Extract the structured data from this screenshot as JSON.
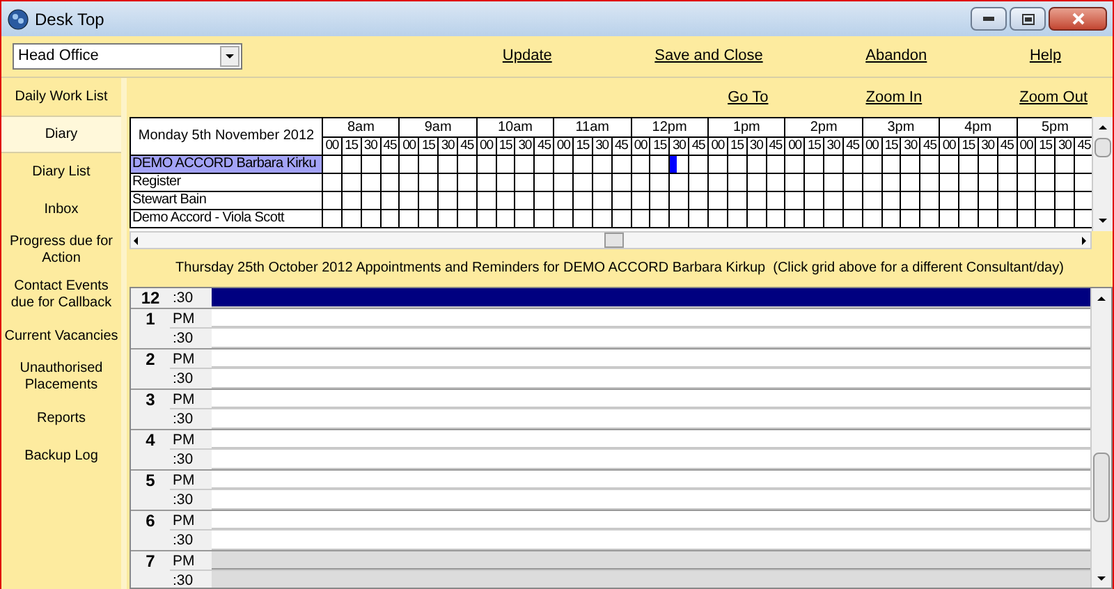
{
  "window": {
    "title": "Desk Top"
  },
  "office_select": {
    "value": "Head Office"
  },
  "menu_links": [
    "Update",
    "Save and Close",
    "Abandon",
    "Help"
  ],
  "sidebar": {
    "items": [
      {
        "label": "Daily Work List",
        "selected": false
      },
      {
        "label": "Diary",
        "selected": true
      },
      {
        "label": "Diary List",
        "selected": false
      },
      {
        "label": "Inbox",
        "selected": false
      },
      {
        "label": "Progress due for Action",
        "selected": false
      },
      {
        "label": "Contact Events due for Callback",
        "selected": false
      },
      {
        "label": "Current Vacancies",
        "selected": false
      },
      {
        "label": "Unauthorised Placements",
        "selected": false
      },
      {
        "label": "Reports",
        "selected": false
      },
      {
        "label": "Backup Log",
        "selected": false
      }
    ]
  },
  "grid_links": [
    "Go To",
    "Zoom In",
    "Zoom Out"
  ],
  "overview": {
    "date": "Monday 5th November 2012",
    "hours": [
      {
        "label": "8am",
        "minutes": [
          {
            "label": "00",
            "cursor": false
          },
          {
            "label": "15",
            "cursor": false
          },
          {
            "label": "30",
            "cursor": false
          },
          {
            "label": "45",
            "cursor": false
          }
        ]
      },
      {
        "label": "9am",
        "minutes": [
          {
            "label": "00",
            "cursor": false
          },
          {
            "label": "15",
            "cursor": false
          },
          {
            "label": "30",
            "cursor": false
          },
          {
            "label": "45",
            "cursor": false
          }
        ]
      },
      {
        "label": "10am",
        "minutes": [
          {
            "label": "00",
            "cursor": false
          },
          {
            "label": "15",
            "cursor": false
          },
          {
            "label": "30",
            "cursor": false
          },
          {
            "label": "45",
            "cursor": false
          }
        ]
      },
      {
        "label": "11am",
        "minutes": [
          {
            "label": "00",
            "cursor": false
          },
          {
            "label": "15",
            "cursor": false
          },
          {
            "label": "30",
            "cursor": false
          },
          {
            "label": "45",
            "cursor": false
          }
        ]
      },
      {
        "label": "12pm",
        "minutes": [
          {
            "label": "00",
            "cursor": false
          },
          {
            "label": "15",
            "cursor": false
          },
          {
            "label": "30",
            "cursor": true
          },
          {
            "label": "45",
            "cursor": false
          }
        ]
      },
      {
        "label": "1pm",
        "minutes": [
          {
            "label": "00",
            "cursor": false
          },
          {
            "label": "15",
            "cursor": false
          },
          {
            "label": "30",
            "cursor": false
          },
          {
            "label": "45",
            "cursor": false
          }
        ]
      },
      {
        "label": "2pm",
        "minutes": [
          {
            "label": "00",
            "cursor": false
          },
          {
            "label": "15",
            "cursor": false
          },
          {
            "label": "30",
            "cursor": false
          },
          {
            "label": "45",
            "cursor": false
          }
        ]
      },
      {
        "label": "3pm",
        "minutes": [
          {
            "label": "00",
            "cursor": false
          },
          {
            "label": "15",
            "cursor": false
          },
          {
            "label": "30",
            "cursor": false
          },
          {
            "label": "45",
            "cursor": false
          }
        ]
      },
      {
        "label": "4pm",
        "minutes": [
          {
            "label": "00",
            "cursor": false
          },
          {
            "label": "15",
            "cursor": false
          },
          {
            "label": "30",
            "cursor": false
          },
          {
            "label": "45",
            "cursor": false
          }
        ]
      },
      {
        "label": "5pm",
        "minutes": [
          {
            "label": "00",
            "cursor": false
          },
          {
            "label": "15",
            "cursor": false
          },
          {
            "label": "30",
            "cursor": false
          },
          {
            "label": "45",
            "cursor": false
          }
        ]
      }
    ],
    "rows": [
      {
        "name": "DEMO ACCORD Barbara Kirku",
        "selected": true
      },
      {
        "name": "Register",
        "selected": false
      },
      {
        "name": "Stewart Bain",
        "selected": false
      },
      {
        "name": "Demo Accord - Viola Scott",
        "selected": false
      }
    ]
  },
  "caption": "Thursday 25th October 2012 Appointments and Reminders for DEMO ACCORD Barbara Kirkup  (Click grid above for a different Consultant/day)",
  "day_view": {
    "blocks": [
      {
        "hour": "12",
        "slots": [
          {
            "label": ":30",
            "selected": true,
            "shaded": false
          }
        ]
      },
      {
        "hour": "1",
        "slots": [
          {
            "label": "PM",
            "selected": false,
            "shaded": false
          },
          {
            "label": ":30",
            "selected": false,
            "shaded": false
          }
        ]
      },
      {
        "hour": "2",
        "slots": [
          {
            "label": "PM",
            "selected": false,
            "shaded": false
          },
          {
            "label": ":30",
            "selected": false,
            "shaded": false
          }
        ]
      },
      {
        "hour": "3",
        "slots": [
          {
            "label": "PM",
            "selected": false,
            "shaded": false
          },
          {
            "label": ":30",
            "selected": false,
            "shaded": false
          }
        ]
      },
      {
        "hour": "4",
        "slots": [
          {
            "label": "PM",
            "selected": false,
            "shaded": false
          },
          {
            "label": ":30",
            "selected": false,
            "shaded": false
          }
        ]
      },
      {
        "hour": "5",
        "slots": [
          {
            "label": "PM",
            "selected": false,
            "shaded": false
          },
          {
            "label": ":30",
            "selected": false,
            "shaded": false
          }
        ]
      },
      {
        "hour": "6",
        "slots": [
          {
            "label": "PM",
            "selected": false,
            "shaded": false
          },
          {
            "label": ":30",
            "selected": false,
            "shaded": false
          }
        ]
      },
      {
        "hour": "7",
        "slots": [
          {
            "label": "PM",
            "selected": false,
            "shaded": true
          },
          {
            "label": ":30",
            "selected": false,
            "shaded": true
          }
        ]
      }
    ]
  }
}
